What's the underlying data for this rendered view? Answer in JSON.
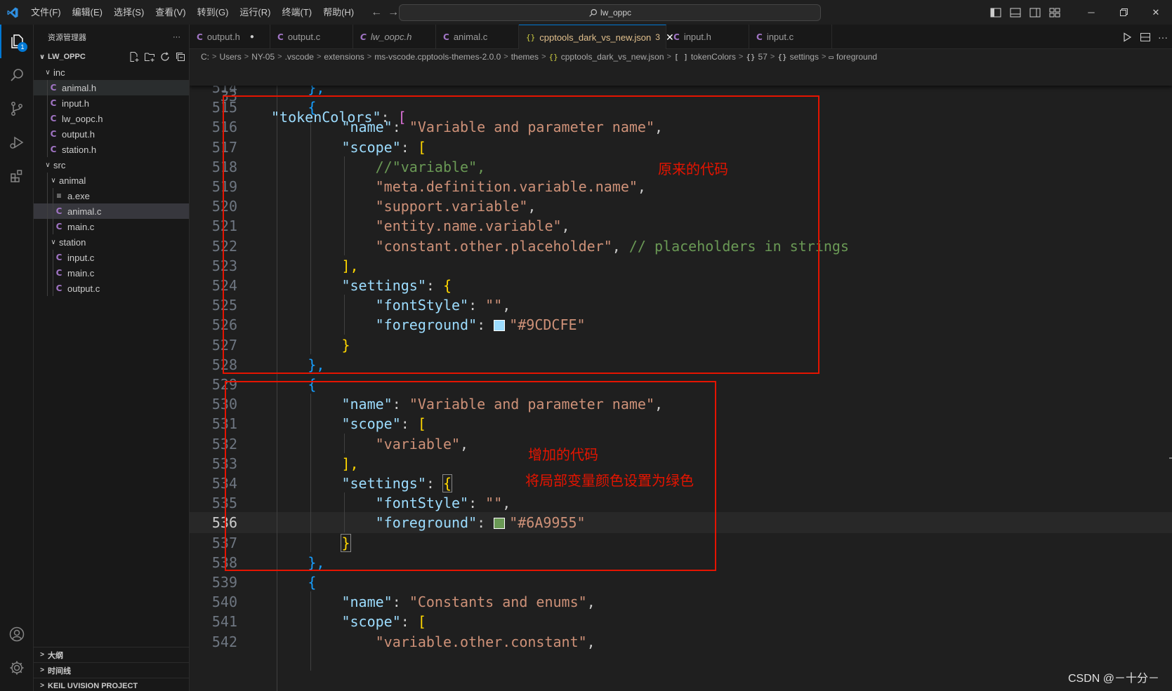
{
  "titlebar": {
    "menu": [
      "文件(F)",
      "编辑(E)",
      "选择(S)",
      "查看(V)",
      "转到(G)",
      "运行(R)",
      "终端(T)",
      "帮助(H)"
    ],
    "search_text": "lw_oppc"
  },
  "activity": {
    "explorer_badge": "1"
  },
  "sidebar": {
    "header": "资源管理器",
    "more": "···",
    "project": "LW_OPPC",
    "tree": {
      "inc": "inc",
      "inc_files": [
        "animal.h",
        "input.h",
        "lw_oopc.h",
        "output.h",
        "station.h"
      ],
      "src": "src",
      "animal_folder": "animal",
      "animal_files": [
        "a.exe",
        "animal.c",
        "main.c"
      ],
      "station_folder": "station",
      "station_files": [
        "input.c",
        "main.c",
        "output.c"
      ]
    },
    "bottom_sections": [
      "大纲",
      "时间线",
      "KEIL UVISION PROJECT"
    ]
  },
  "tabs": [
    {
      "label": "output.h",
      "modified": "●"
    },
    {
      "label": "output.c"
    },
    {
      "label": "lw_oopc.h"
    },
    {
      "label": "animal.c"
    },
    {
      "label": "cpptools_dark_vs_new.json",
      "problems": "3",
      "close": "✕"
    },
    {
      "label": "input.h"
    },
    {
      "label": "input.c"
    }
  ],
  "breadcrumb": {
    "parts": [
      "C:",
      "Users",
      "NY-05",
      ".vscode",
      "extensions",
      "ms-vscode.cpptools-themes-2.0.0",
      "themes"
    ],
    "file": "cpptools_dark_vs_new.json",
    "sym1": "tokenColors",
    "sym2": "57",
    "sym3": "settings",
    "sym4": "foreground"
  },
  "editor": {
    "sticky_line": {
      "num": "33",
      "key": "\"tokenColors\"",
      "colon": ": ",
      "bracket": "["
    },
    "lines": [
      {
        "num": "514",
        "text": "},",
        "kind": "close_obj"
      },
      {
        "num": "515",
        "text": "{",
        "kind": "open_obj"
      },
      {
        "num": "516",
        "key": "\"name\"",
        "value": "\"Variable and parameter name\"",
        "kind": "kv"
      },
      {
        "num": "517",
        "key": "\"scope\"",
        "kind": "arr_open"
      },
      {
        "num": "518",
        "comment": "//\"variable\",",
        "kind": "comment_item"
      },
      {
        "num": "519",
        "value": "\"meta.definition.variable.name\"",
        "kind": "item"
      },
      {
        "num": "520",
        "value": "\"support.variable\"",
        "kind": "item"
      },
      {
        "num": "521",
        "value": "\"entity.name.variable\"",
        "kind": "item"
      },
      {
        "num": "522",
        "value": "\"constant.other.placeholder\"",
        "trail_comment": "// placeholders in strings",
        "kind": "item_comment"
      },
      {
        "num": "523",
        "text": "],",
        "kind": "arr_close"
      },
      {
        "num": "524",
        "key": "\"settings\"",
        "kind": "obj_open"
      },
      {
        "num": "525",
        "key": "\"fontStyle\"",
        "value": "\"\"",
        "kind": "kv_inner"
      },
      {
        "num": "526",
        "key": "\"foreground\"",
        "value": "\"#9CDCFE\"",
        "swatch": "#9CDCFE",
        "kind": "kv_color"
      },
      {
        "num": "527",
        "text": "}",
        "kind": "obj_close"
      },
      {
        "num": "528",
        "text": "},",
        "kind": "close_obj"
      },
      {
        "num": "529",
        "text": "{",
        "kind": "open_obj"
      },
      {
        "num": "530",
        "key": "\"name\"",
        "value": "\"Variable and parameter name\"",
        "kind": "kv"
      },
      {
        "num": "531",
        "key": "\"scope\"",
        "kind": "arr_open"
      },
      {
        "num": "532",
        "value": "\"variable\"",
        "kind": "item_last"
      },
      {
        "num": "533",
        "text": "],",
        "kind": "arr_close"
      },
      {
        "num": "534",
        "key": "\"settings\"",
        "kind": "obj_open_boxed"
      },
      {
        "num": "535",
        "key": "\"fontStyle\"",
        "value": "\"\"",
        "kind": "kv_inner"
      },
      {
        "num": "536",
        "key": "\"foreground\"",
        "value": "\"#6A9955\"",
        "swatch": "#6A9955",
        "kind": "kv_color_last",
        "current": true
      },
      {
        "num": "537",
        "text": "}",
        "kind": "obj_close_boxed"
      },
      {
        "num": "538",
        "text": "},",
        "kind": "close_obj"
      },
      {
        "num": "539",
        "text": "{",
        "kind": "open_obj"
      },
      {
        "num": "540",
        "key": "\"name\"",
        "value": "\"Constants and enums\"",
        "kind": "kv"
      },
      {
        "num": "541",
        "key": "\"scope\"",
        "kind": "arr_open"
      },
      {
        "num": "542",
        "value": "\"variable.other.constant\"",
        "kind": "item"
      }
    ]
  },
  "annotations": {
    "original": "原来的代码",
    "added": "增加的代码",
    "added_desc": "将局部变量颜色设置为绿色"
  },
  "watermark": "CSDN @－十分－"
}
